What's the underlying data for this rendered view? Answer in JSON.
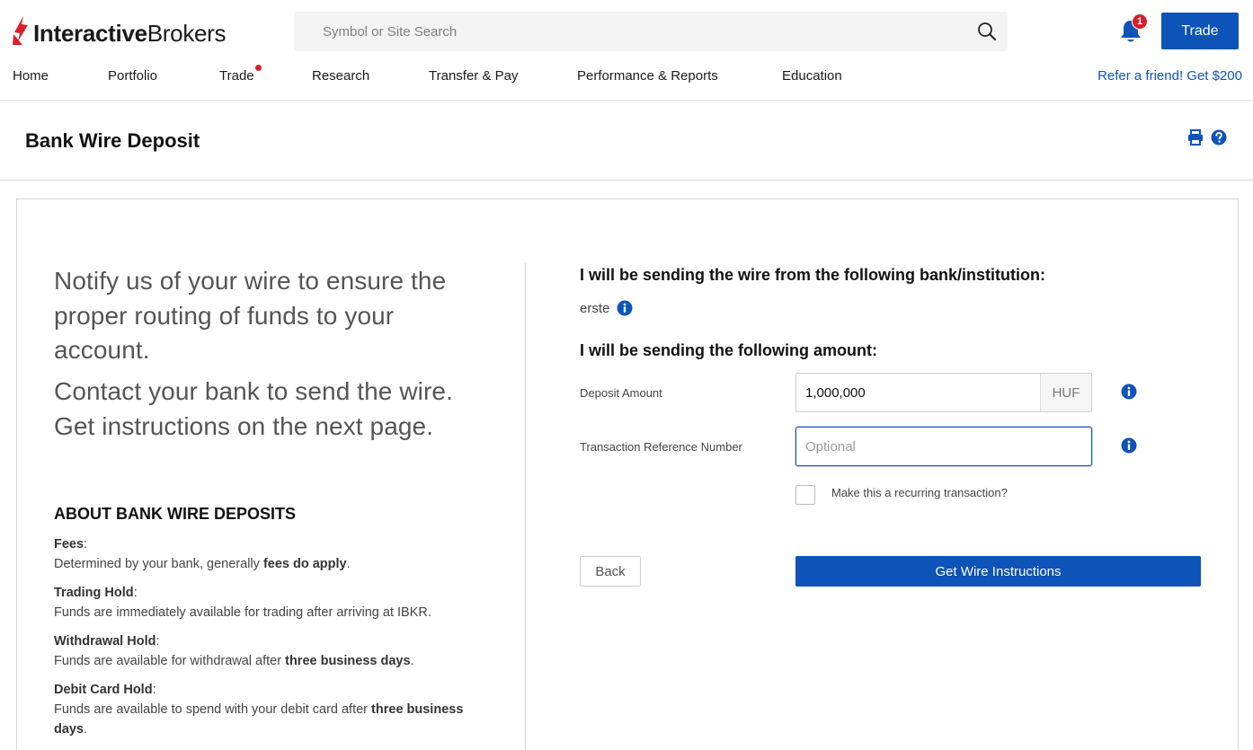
{
  "brand": {
    "name_bold": "Interactive",
    "name_regular": "Brokers",
    "accent": "#d6202c",
    "primary": "#0e53b8"
  },
  "header": {
    "search_placeholder": "Symbol or Site Search",
    "notifications_count": "1",
    "trade_label": "Trade",
    "refer_label": "Refer a friend! Get $200"
  },
  "nav": {
    "items": [
      {
        "label": "Home"
      },
      {
        "label": "Portfolio"
      },
      {
        "label": "Trade"
      },
      {
        "label": "Research"
      },
      {
        "label": "Transfer & Pay"
      },
      {
        "label": "Performance & Reports"
      },
      {
        "label": "Education"
      }
    ]
  },
  "page": {
    "title": "Bank Wire Deposit"
  },
  "left": {
    "lead1": "Notify us of your wire to ensure the proper routing of funds to your account.",
    "lead2": "Contact your bank to send the wire. Get instructions on the next page.",
    "about_title": "ABOUT BANK WIRE DEPOSITS",
    "facts": [
      {
        "label": "Fees",
        "pre": "Determined by your bank, generally ",
        "bold": "fees do apply",
        "post": "."
      },
      {
        "label": "Trading Hold",
        "pre": "Funds are immediately available for trading after arriving at IBKR.",
        "bold": "",
        "post": ""
      },
      {
        "label": "Withdrawal Hold",
        "pre": "Funds are available for withdrawal after ",
        "bold": "three business days",
        "post": "."
      },
      {
        "label": "Debit Card Hold",
        "pre": "Funds are available to spend with your debit card after ",
        "bold": "three business days",
        "post": "."
      }
    ]
  },
  "form": {
    "bank_heading": "I will be sending the wire from the following bank/institution:",
    "bank_name": "erste",
    "amount_heading": "I will be sending the following amount:",
    "deposit_label": "Deposit Amount",
    "deposit_value": "1,000,000",
    "currency": "HUF",
    "ref_label": "Transaction Reference Number",
    "ref_placeholder": "Optional",
    "recurring_label": "Make this a recurring transaction?",
    "back_label": "Back",
    "submit_label": "Get Wire Instructions"
  }
}
